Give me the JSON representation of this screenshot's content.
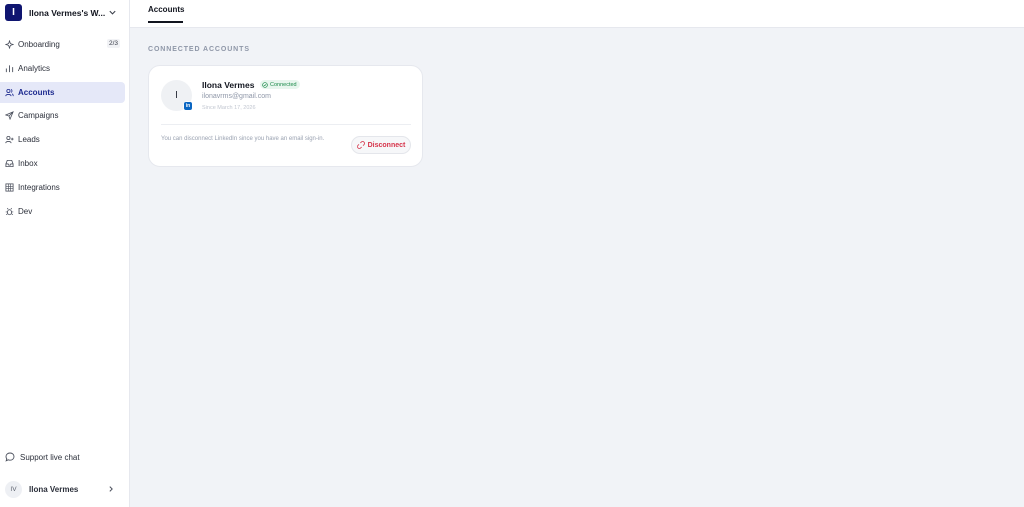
{
  "sidebar": {
    "workspace": {
      "badge": "I",
      "name": "Ilona Vermes's W..."
    },
    "items": [
      {
        "key": "onboarding",
        "label": "Onboarding",
        "icon": "sparkle-icon",
        "badge": "2/3",
        "active": false
      },
      {
        "key": "analytics",
        "label": "Analytics",
        "icon": "bar-chart-icon",
        "active": false
      },
      {
        "key": "accounts",
        "label": "Accounts",
        "icon": "users-icon",
        "active": true
      },
      {
        "key": "campaigns",
        "label": "Campaigns",
        "icon": "send-icon",
        "active": false
      },
      {
        "key": "leads",
        "label": "Leads",
        "icon": "user-plus-icon",
        "active": false
      },
      {
        "key": "inbox",
        "label": "Inbox",
        "icon": "inbox-icon",
        "active": false
      },
      {
        "key": "integrations",
        "label": "Integrations",
        "icon": "grid-icon",
        "active": false
      },
      {
        "key": "dev",
        "label": "Dev",
        "icon": "bug-icon",
        "active": false
      }
    ],
    "support_label": "Support live chat",
    "user": {
      "initials": "IV",
      "name": "Ilona Vermes"
    }
  },
  "topbar": {
    "tab_label": "Accounts"
  },
  "main": {
    "section_title": "CONNECTED ACCOUNTS",
    "account": {
      "avatar_initial": "I",
      "provider_badge": "in",
      "name": "Ilona Vermes",
      "status": "Connected",
      "email": "ilonavrms@gmail.com",
      "since": "Since March 17, 2026",
      "notice": "You can disconnect LinkedIn since you have an email sign-in.",
      "disconnect_label": "Disconnect"
    }
  },
  "colors": {
    "brand": "#0f1570",
    "active_nav_bg": "#e5e8f8",
    "active_nav_text": "#1d2a8f",
    "connected": "#1c8a4a",
    "disconnect": "#d6334a",
    "linkedin": "#0a66c2"
  }
}
